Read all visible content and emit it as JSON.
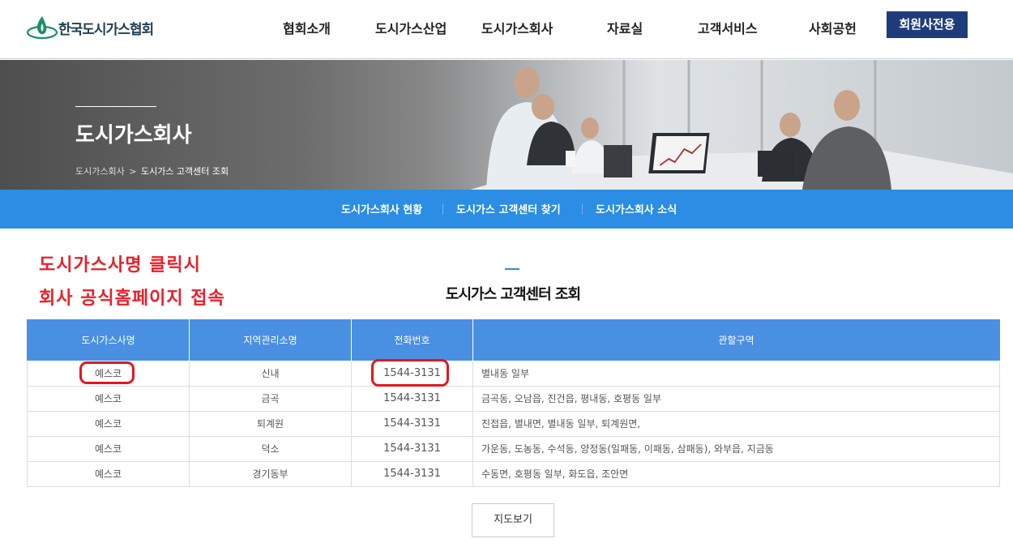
{
  "header": {
    "logo_text": "한국도시가스협회",
    "nav": [
      {
        "label": "협회소개"
      },
      {
        "label": "도시가스산업"
      },
      {
        "label": "도시가스회사"
      },
      {
        "label": "자료실"
      },
      {
        "label": "고객서비스"
      },
      {
        "label": "사회공헌"
      }
    ],
    "member_button": "회원사전용"
  },
  "hero": {
    "title": "도시가스회사",
    "breadcrumb": {
      "parent": "도시가스회사",
      "separator": ">",
      "current": "도시가스 고객센터 조회"
    }
  },
  "subnav": [
    {
      "label": "도시가스회사 현황"
    },
    {
      "label": "도시가스 고객센터 찾기"
    },
    {
      "label": "도시가스회사 소식"
    }
  ],
  "annotation": {
    "line1": "도시가스사명 클릭시",
    "line2": "회사 공식홈페이지 접속"
  },
  "section": {
    "title": "도시가스 고객센터 조회"
  },
  "table": {
    "columns": [
      "도시가스사명",
      "지역관리소명",
      "전화번호",
      "관할구역"
    ],
    "rows": [
      {
        "company": "예스코",
        "office": "신내",
        "phone": "1544-3131",
        "area": "별내동 일부"
      },
      {
        "company": "예스코",
        "office": "금곡",
        "phone": "1544-3131",
        "area": "금곡동, 오남읍, 진건읍, 평내동, 호평동 일부"
      },
      {
        "company": "예스코",
        "office": "퇴계원",
        "phone": "1544-3131",
        "area": "진접읍, 별내면, 별내동 일부, 퇴계원면,"
      },
      {
        "company": "예스코",
        "office": "덕소",
        "phone": "1544-3131",
        "area": "가운동, 도농동, 수석동, 양정동(일패동, 이패동, 삼패동), 와부읍, 지금동"
      },
      {
        "company": "예스코",
        "office": "경기동부",
        "phone": "1544-3131",
        "area": "수동면, 호평동 일부, 화도읍, 조안면"
      }
    ]
  },
  "map_button": "지도보기",
  "colors": {
    "brand_navy": "#1f3c7a",
    "subnav_blue": "#2b8de4",
    "table_header": "#4a90e2",
    "annotation_red": "#e8202a"
  }
}
